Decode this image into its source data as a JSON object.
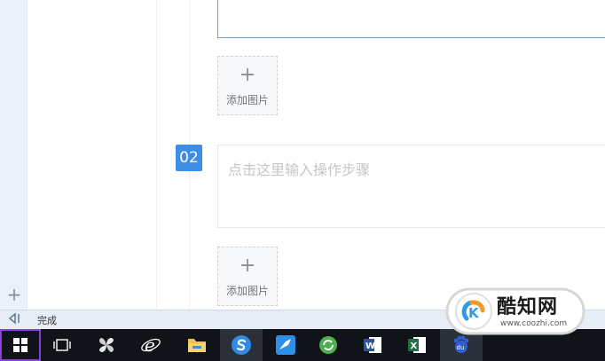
{
  "editor": {
    "step_number": "02",
    "step_placeholder": "点击这里输入操作步骤",
    "add_image_label": "添加图片"
  },
  "statusbar": {
    "text": "完成"
  },
  "taskbar": {
    "icons": [
      "windows-icon",
      "task-view-icon",
      "pinwheel-app-icon",
      "ie-icon",
      "file-explorer-icon",
      "sogou-browser-icon",
      "feather-app-icon",
      "refresh-app-icon",
      "word-icon",
      "excel-icon",
      "baidu-icon"
    ]
  },
  "watermark": {
    "name": "酷知网",
    "url": "www.coozhi.com"
  },
  "colors": {
    "accent": "#3d8ee6",
    "taskbar": "#101317"
  }
}
